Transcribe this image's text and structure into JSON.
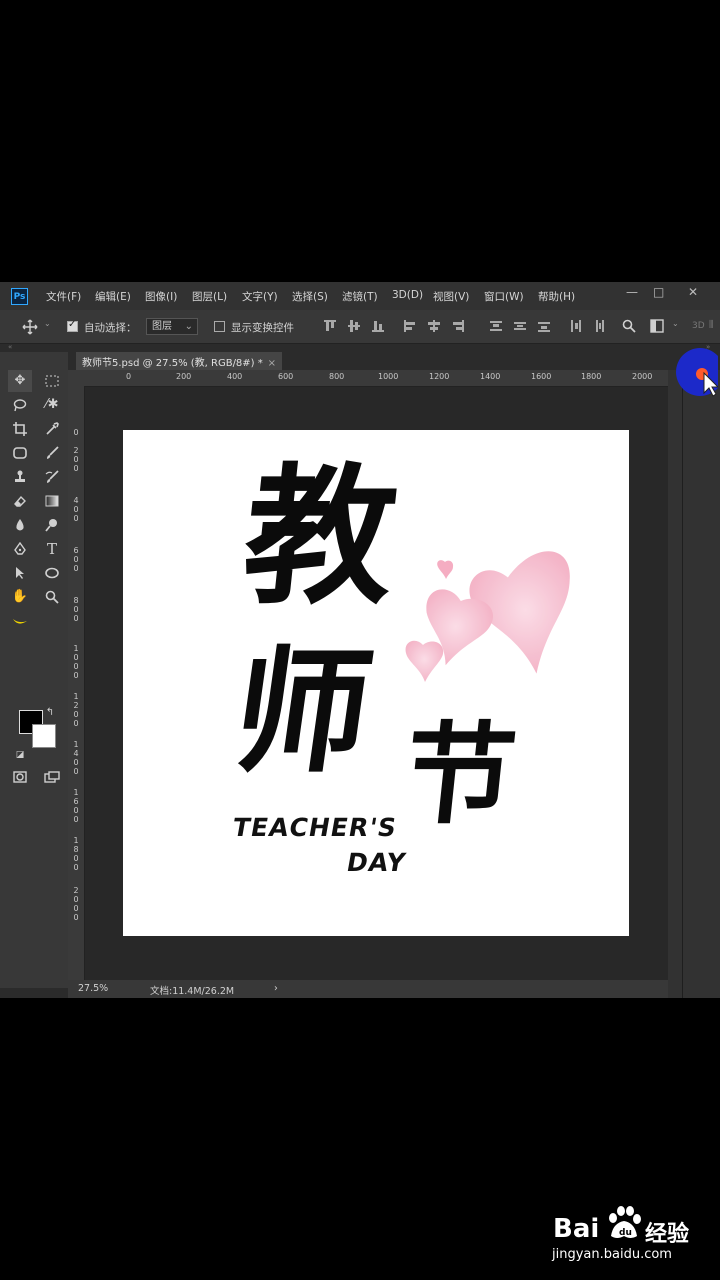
{
  "app": {
    "logo": "Ps",
    "menu": [
      "文件(F)",
      "编辑(E)",
      "图像(I)",
      "图层(L)",
      "文字(Y)",
      "选择(S)",
      "滤镜(T)",
      "3D(D)",
      "视图(V)",
      "窗口(W)",
      "帮助(H)"
    ],
    "window_buttons": [
      "—",
      "□",
      "✕"
    ]
  },
  "options": {
    "auto_select_label": "自动选择：",
    "auto_select_checked": true,
    "layer_select_value": "图层",
    "show_transform_label": "显示变换控件",
    "show_transform_checked": false,
    "mode_3d_label": "3D"
  },
  "document": {
    "tab_title": "教师节5.psd @ 27.5% (教, RGB/8#) *",
    "close_glyph": "×",
    "ruler_h": [
      "0",
      "200",
      "400",
      "600",
      "800",
      "1000",
      "1200",
      "1400",
      "1600",
      "1800",
      "2000"
    ],
    "ruler_v": [
      "0",
      "2 0 0",
      "4 0 0",
      "6 0 0",
      "8 0 0",
      "1 0 0 0",
      "1 2 0 0",
      "1 4 0 0",
      "1 6 0 0",
      "1 8 0 0",
      "2 0 0 0"
    ]
  },
  "artwork": {
    "characters": [
      "教",
      "师",
      "节"
    ],
    "text_line1": "TEACHER'S",
    "text_line2": "DAY",
    "heart_color": "#f4b6c8"
  },
  "status": {
    "zoom": "27.5%",
    "doc_info": "文档:11.4M/26.2M",
    "arrow": "›"
  },
  "watermark": {
    "brand": "Bai",
    "brand2": "经验",
    "url": "jingyan.baidu.com"
  },
  "colors": {
    "foreground": "#000000",
    "background": "#ffffff",
    "accent": "#31a8ff"
  }
}
